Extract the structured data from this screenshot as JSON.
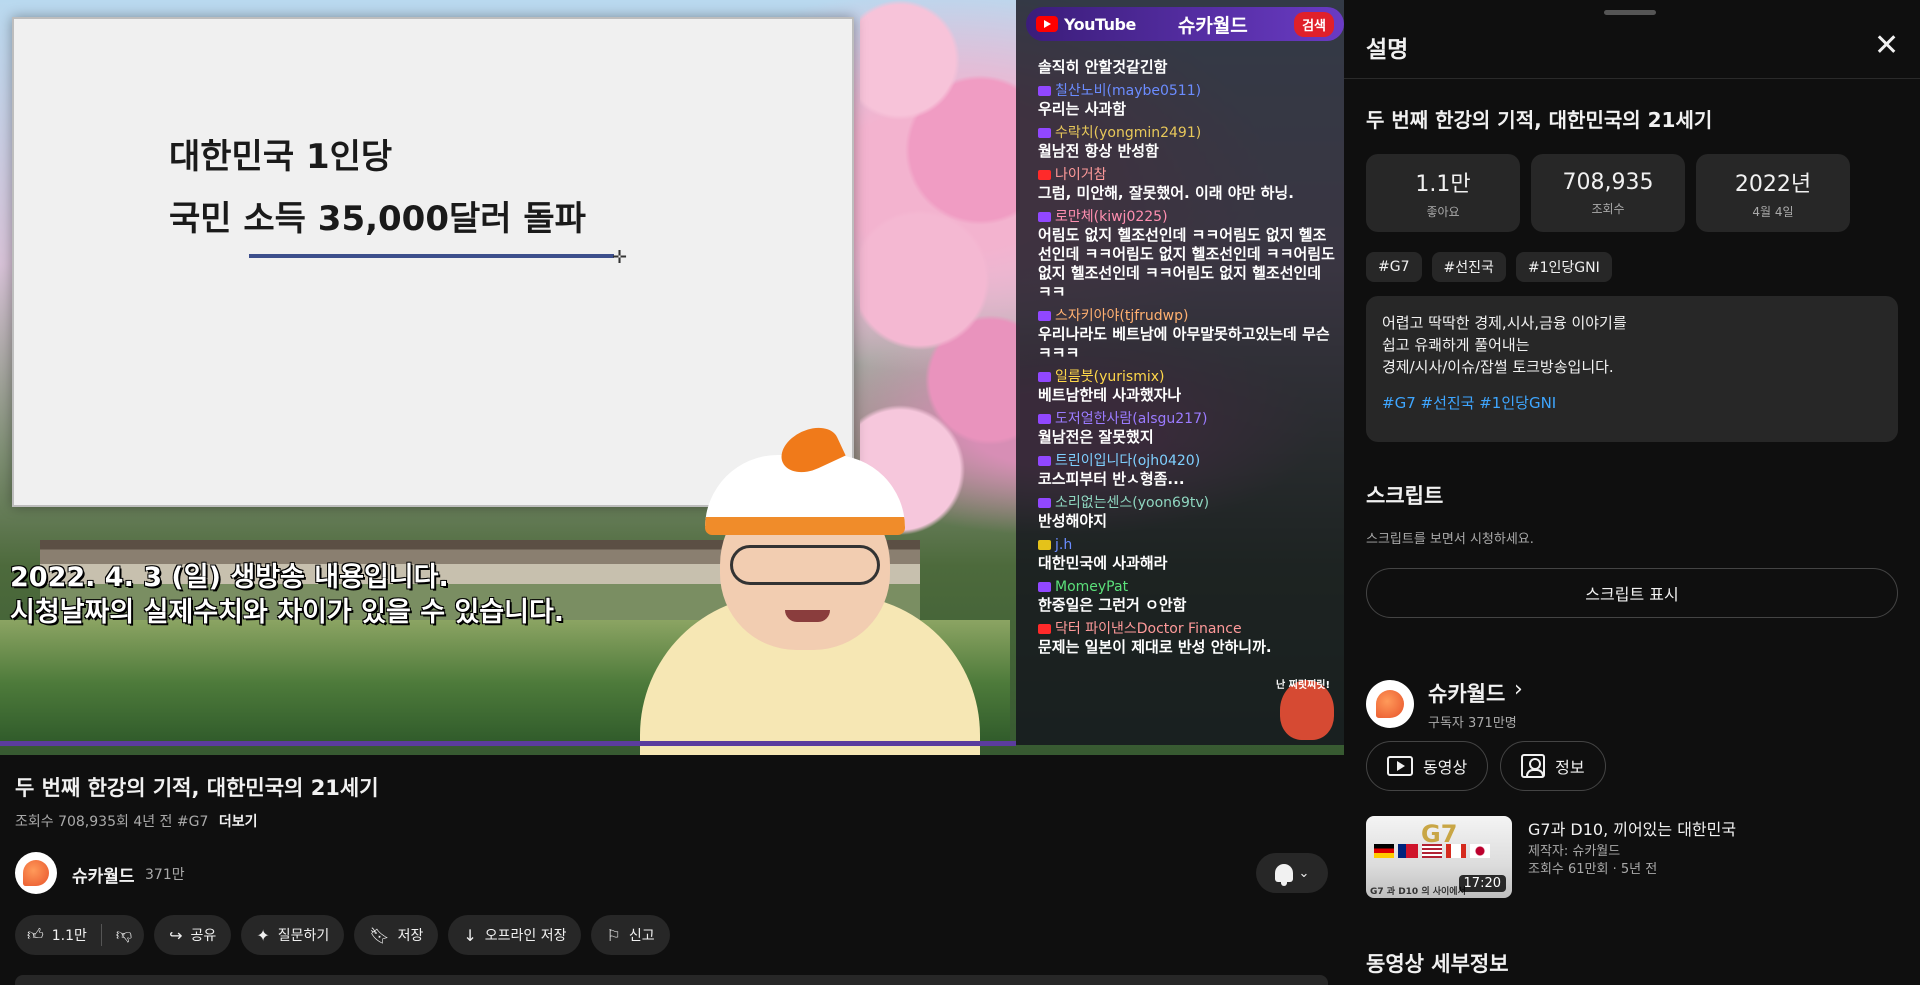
{
  "player": {
    "slide": {
      "line1": "대한민국 1인당",
      "line2": "국민 소득 35,000달러 돌파"
    },
    "subtitle1": "2022. 4. 3 (일) 생방송 내용입니다.",
    "subtitle2": "시청날짜의 실제수치와 차이가 있을 수 있습니다.",
    "chat": {
      "header_logo": "YouTube",
      "header_channel": "슈카월드",
      "header_search": "검색",
      "mascot_text": "난 찌릿찌릿!",
      "messages": [
        {
          "user": "",
          "text": "솔직히 안할것같긴함",
          "badge": "none",
          "color": "#ffffff"
        },
        {
          "user": "칠산노비(maybe0511)",
          "text": "우리는 사과함",
          "badge": "twitch",
          "color": "#6b8cff"
        },
        {
          "user": "수락치(yongmin2491)",
          "text": "월남전 항상 반성함",
          "badge": "twitch",
          "color": "#e8c85a"
        },
        {
          "user": "나이거참",
          "text": "그럼, 미안해, 잘못했어. 이래 야만 하닝.",
          "badge": "youtube",
          "color": "#ff9a9a"
        },
        {
          "user": "로만체(kiwj0225)",
          "text": "어림도 없지 헬조선인데 ㅋㅋ어림도 없지 헬조선인데 ㅋㅋ어림도 없지 헬조선인데 ㅋㅋ어림도 없지 헬조선인데 ㅋㅋ어림도 없지 헬조선인데 ㅋㅋ",
          "badge": "twitch",
          "color": "#ff8fb0"
        },
        {
          "user": "스자키아야(tjfrudwp)",
          "text": "우리나라도 베트남에 아무말못하고있는데 무슨 ㅋㅋㅋ",
          "badge": "twitch",
          "color": "#ffb070"
        },
        {
          "user": "일름붓(yurismix)",
          "text": "베트남한테 사과했자나",
          "badge": "twitch",
          "color": "#ffd84a"
        },
        {
          "user": "도저얼한사람(alsgu217)",
          "text": "월남전은 잘못했지",
          "badge": "twitch",
          "color": "#9b7bff"
        },
        {
          "user": "트린이입니다(ojh0420)",
          "text": "코스피부터 반ㅅ형좀...",
          "badge": "twitch",
          "color": "#7fd0ff"
        },
        {
          "user": "소리없는센스(yoon69tv)",
          "text": "반성해야지",
          "badge": "twitch",
          "color": "#8fd6c0"
        },
        {
          "user": "j.h",
          "text": "대한민국에 사과해라",
          "badge": "star",
          "color": "#6b8cff"
        },
        {
          "user": "MomeyPat",
          "text": "한중일은 그런거 ㅇ안함",
          "badge": "twitch",
          "color": "#5be07a"
        },
        {
          "user": "닥터 파이낸스Doctor Finance",
          "text": "문제는 일본이 제대로 반성 안하니까.",
          "badge": "youtube",
          "color": "#ff9a9a"
        }
      ]
    }
  },
  "video": {
    "title": "두 번째 한강의 기적, 대한민국의 21세기",
    "meta": "조회수 708,935회 4년 전 #G7",
    "more": "더보기",
    "channel_name": "슈카월드",
    "channel_subs": "371만"
  },
  "actions": {
    "like": "1.1만",
    "share": "공유",
    "ask": "질문하기",
    "save": "저장",
    "offline": "오프라인 저장",
    "report": "신고"
  },
  "panel": {
    "title": "설명",
    "close_icon": "close-icon",
    "video_title": "두 번째 한강의 기적, 대한민국의 21세기",
    "stats": [
      {
        "value": "1.1만",
        "label": "좋아요"
      },
      {
        "value": "708,935",
        "label": "조회수"
      },
      {
        "value": "2022년",
        "label": "4월 4일"
      }
    ],
    "hashtags": [
      "#G7",
      "#선진국",
      "#1인당GNI"
    ],
    "description": [
      "어렵고 딱딱한 경제,시사,금융 이야기를",
      "쉽고 유쾌하게 풀어내는",
      "경제/시사/이슈/잡썰 토크방송입니다."
    ],
    "description_tags": "#G7 #선진국 #1인당GNI",
    "script_title": "스크립트",
    "script_sub": "스크립트를 보면서 시청하세요.",
    "script_button": "스크립트 표시",
    "channel_name": "슈카월드",
    "channel_subs": "구독자 371만명",
    "videos_button": "동영상",
    "about_button": "정보",
    "related": {
      "title": "G7과 D10, 끼어있는 대한민국",
      "by": "제작자: 슈카월드",
      "meta": "조회수 61만회 · 5년 전",
      "duration": "17:20",
      "thumb_text": "G7",
      "thumb_caption": "G7 과 D10 의 사이에서"
    },
    "details_title": "동영상 세부정보"
  },
  "colors": {
    "background": "#0f0f0f",
    "surface": "#272727",
    "link": "#3ea6ff",
    "youtube_red": "#ff0000"
  }
}
